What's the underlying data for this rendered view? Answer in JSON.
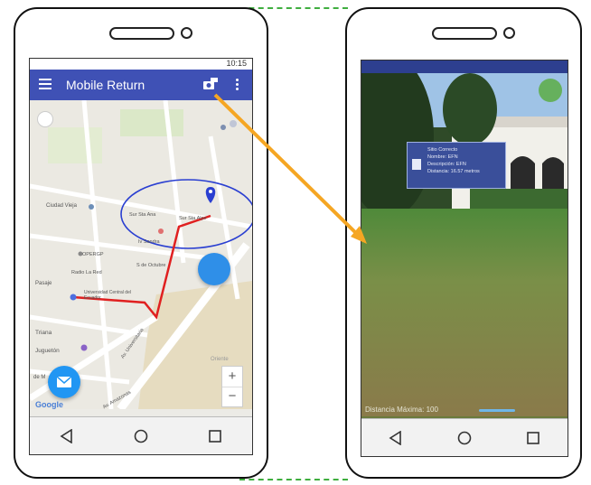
{
  "left_phone": {
    "status_time": "10:15",
    "app_title": "Mobile Return",
    "map_labels": {
      "l1": "Ciudad Vieja",
      "l2": "Sur Sta Ana",
      "l3": "Sur Sta Alpe",
      "l4": "Iv Sandra",
      "l5": "OPERGP",
      "l6": "Radio La Red",
      "l7": "S de Octubre",
      "l8": "Pasaje",
      "l9": "Universidad Central del Ecuador",
      "l10": "Triana",
      "l11": "Juguetón",
      "l12": "Av. Universitaria",
      "l13": "de M",
      "l14": "Av. Amazonas",
      "l15": "Google",
      "l16": "Oriente"
    },
    "zoom_in": "+",
    "zoom_out": "−"
  },
  "right_phone": {
    "info_card": {
      "line1": "Sitio Correcto",
      "line2": "Nombre: EFN",
      "line3": "Descripción: EFN",
      "line4": "Distancia: 16.57 metros"
    },
    "bottom_text": "Distancia Máxima: 100"
  },
  "colors": {
    "app_bar": "#3f51b5",
    "route": "#e02020",
    "arrow": "#f5a623",
    "fab": "#2196f3",
    "info_card": "#3a4f9a"
  }
}
